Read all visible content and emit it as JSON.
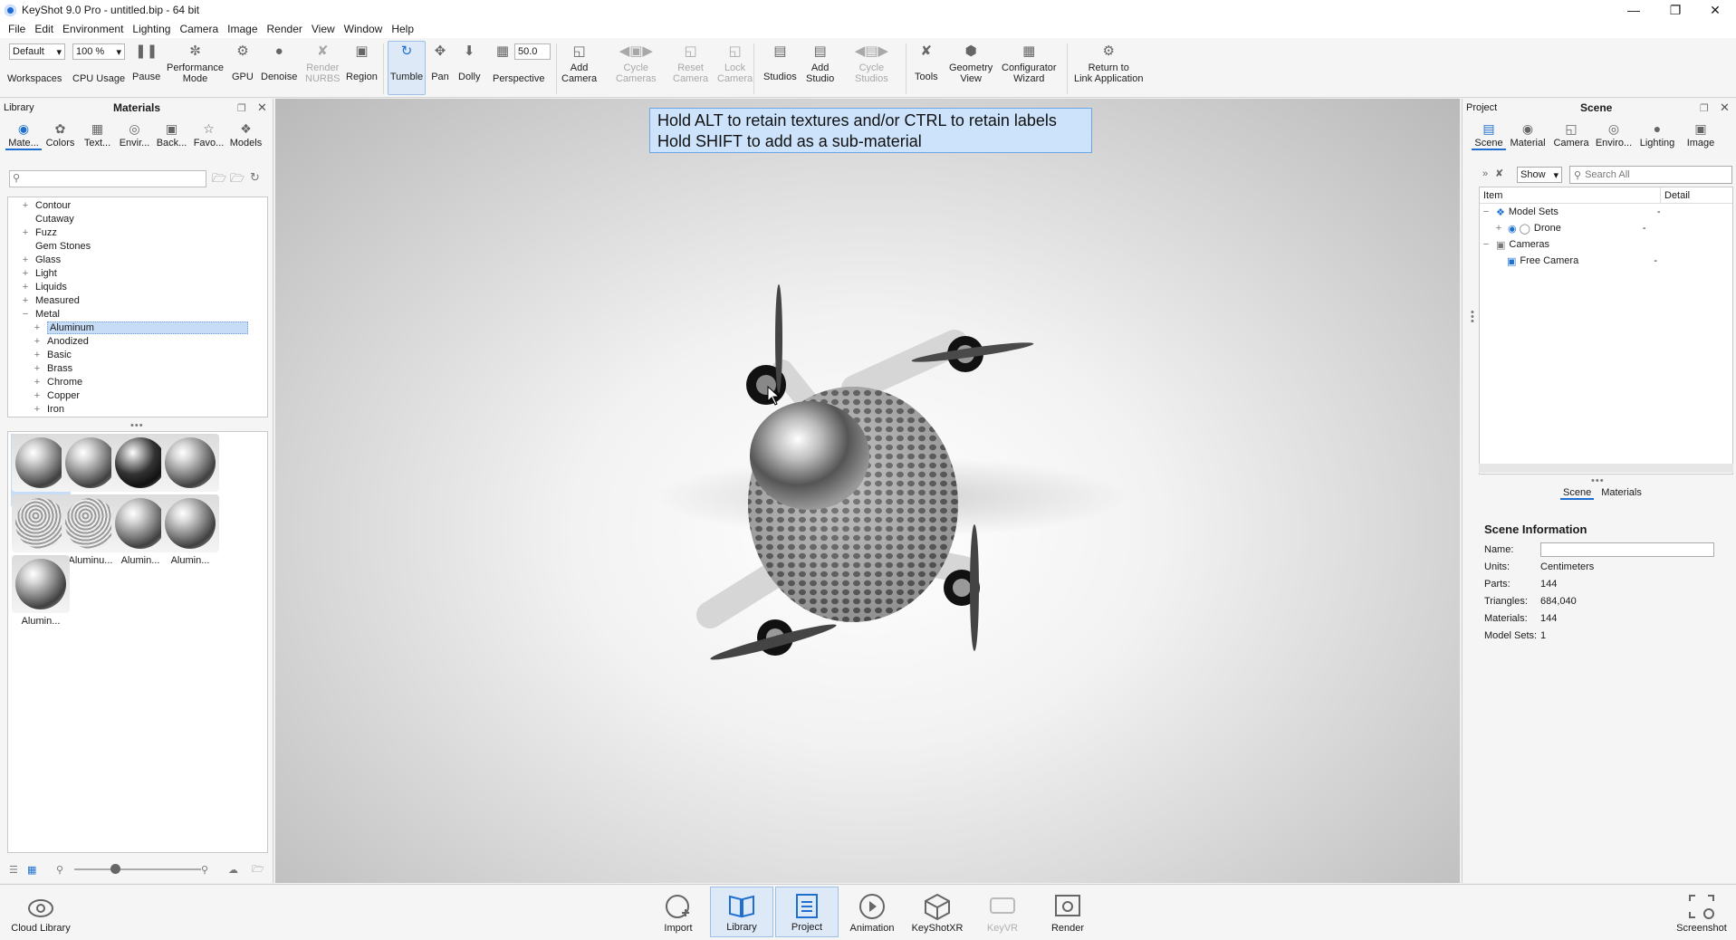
{
  "window": {
    "title": "KeyShot 9.0 Pro  - untitled.bip  - 64 bit"
  },
  "menu": [
    "File",
    "Edit",
    "Environment",
    "Lighting",
    "Camera",
    "Image",
    "Render",
    "View",
    "Window",
    "Help"
  ],
  "toolbar": {
    "workspace_value": "Default",
    "zoom_value": "100 %",
    "fov_value": "50.0",
    "buttons": {
      "workspaces": "Workspaces",
      "cpu_usage": "CPU Usage",
      "pause": "Pause",
      "performance_mode": "Performance\nMode",
      "gpu": "GPU",
      "denoise": "Denoise",
      "render_nurbs": "Render\nNURBS",
      "region": "Region",
      "tumble": "Tumble",
      "pan": "Pan",
      "dolly": "Dolly",
      "perspective": "Perspective",
      "add_camera": "Add\nCamera",
      "cycle_cameras": "Cycle\nCameras",
      "reset_camera": "Reset\nCamera",
      "lock_camera": "Lock\nCamera",
      "studios": "Studios",
      "add_studio": "Add\nStudio",
      "cycle_studios": "Cycle\nStudios",
      "tools": "Tools",
      "geometry_view": "Geometry\nView",
      "configurator_wizard": "Configurator\nWizard",
      "return_to_link": "Return to\nLink Application"
    }
  },
  "library": {
    "panel_label": "Library",
    "title": "Materials",
    "tabs": [
      "Mate...",
      "Colors",
      "Text...",
      "Envir...",
      "Back...",
      "Favo...",
      "Models"
    ],
    "tree": [
      {
        "label": "Contour",
        "exp": "+"
      },
      {
        "label": "Cutaway",
        "exp": ""
      },
      {
        "label": "Fuzz",
        "exp": "+"
      },
      {
        "label": "Gem Stones",
        "exp": ""
      },
      {
        "label": "Glass",
        "exp": "+"
      },
      {
        "label": "Light",
        "exp": "+"
      },
      {
        "label": "Liquids",
        "exp": "+"
      },
      {
        "label": "Measured",
        "exp": "+"
      },
      {
        "label": "Metal",
        "exp": "−"
      }
    ],
    "metal_children": [
      {
        "label": "Aluminum",
        "exp": "+"
      },
      {
        "label": "Anodized",
        "exp": "+"
      },
      {
        "label": "Basic",
        "exp": "+"
      },
      {
        "label": "Brass",
        "exp": "+"
      },
      {
        "label": "Chrome",
        "exp": "+"
      },
      {
        "label": "Copper",
        "exp": "+"
      },
      {
        "label": "Iron",
        "exp": "+"
      }
    ],
    "thumbnails": [
      "Alumin...",
      "Aluminu...",
      "Alumin...",
      "Alumin...",
      "Alumin...",
      "Aluminu...",
      "Alumin...",
      "Alumin...",
      "Alumin..."
    ]
  },
  "viewport": {
    "hint_line1": "Hold ALT to retain textures and/or CTRL to retain labels",
    "hint_line2": "Hold SHIFT to add as a sub-material"
  },
  "project": {
    "panel_label": "Project",
    "title": "Scene",
    "tabs": [
      "Scene",
      "Material",
      "Camera",
      "Enviro...",
      "Lighting",
      "Image"
    ],
    "show_label": "Show",
    "search_placeholder": "Search All",
    "columns": [
      "Item",
      "Detail"
    ],
    "tree": {
      "model_sets": "Model Sets",
      "model_sets_detail": "-",
      "drone": "Drone",
      "drone_detail": "-",
      "cameras": "Cameras",
      "free_camera": "Free Camera",
      "free_camera_detail": "-"
    },
    "subtabs": [
      "Scene",
      "Materials"
    ],
    "info": {
      "heading": "Scene Information",
      "name_label": "Name:",
      "name_value": "",
      "units_label": "Units:",
      "units_value": "Centimeters",
      "parts_label": "Parts:",
      "parts_value": "144",
      "triangles_label": "Triangles:",
      "triangles_value": "684,040",
      "materials_label": "Materials:",
      "materials_value": "144",
      "modelsets_label": "Model Sets:",
      "modelsets_value": "1"
    }
  },
  "bottombar": {
    "cloud_library": "Cloud Library",
    "import": "Import",
    "library": "Library",
    "project": "Project",
    "animation": "Animation",
    "keyshotxr": "KeyShotXR",
    "keyvr": "KeyVR",
    "render": "Render",
    "screenshot": "Screenshot"
  },
  "colors": {
    "accent": "#1e6fd0",
    "selection": "#c7dcf6",
    "hint_bg": "#cde3fb"
  }
}
